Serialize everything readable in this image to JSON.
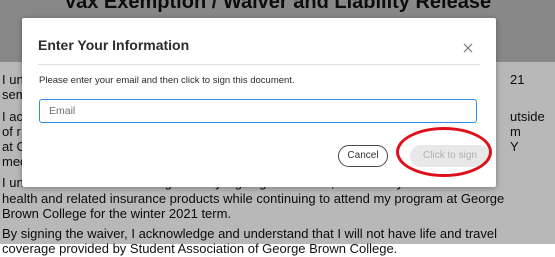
{
  "document": {
    "heading": "Vax Exemption / Waiver and Liability Release",
    "lines": [
      "I un",
      "sem",
      "I ac",
      "of r",
      "at C",
      "med"
    ],
    "right_fragments": [
      "21",
      "utside",
      "m",
      "Y"
    ],
    "partial_line": "I understand and acknowledge that by signing this waiver, I waive any claim to all",
    "para2_line1": "health and related insurance products while continuing to attend my program at George",
    "para2_line2": "Brown College for the winter 2021 term.",
    "para3_line1": "By signing the waiver, I acknowledge and understand that I will not have life and travel",
    "para3_line2": "coverage provided by Student Association of George Brown College."
  },
  "modal": {
    "title": "Enter Your Information",
    "message": "Please enter your email and then click to sign this document.",
    "email_placeholder": "Email",
    "cancel_label": "Cancel",
    "sign_label": "Click to sign"
  },
  "colors": {
    "accent_border": "#2d8ceb",
    "annotation": "#e0101b",
    "disabled_button_bg": "#e8e8e8",
    "disabled_button_text": "#b0b0b0"
  },
  "icons": {
    "close": "close-icon"
  }
}
